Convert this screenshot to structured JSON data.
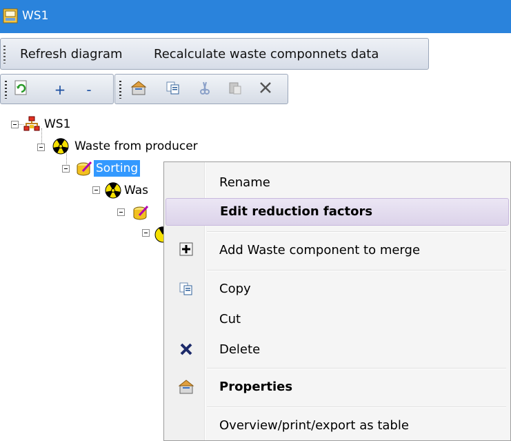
{
  "window": {
    "title": "WS1"
  },
  "menubar": {
    "refresh_label": "Refresh diagram",
    "recalc_label": "Recalculate waste componnets data"
  },
  "toolbar": {
    "plus_label": "+",
    "minus_label": "-"
  },
  "tree": {
    "root_label": "WS1",
    "node1_label": "Waste from producer",
    "node2_label": "Sorting",
    "node3_label": "Was"
  },
  "context_menu": {
    "rename": "Rename",
    "edit_reduction": "Edit reduction factors",
    "add_component": "Add Waste component to merge",
    "copy": "Copy",
    "cut": "Cut",
    "delete": "Delete",
    "properties": "Properties",
    "overview": "Overview/print/export as table"
  },
  "colors": {
    "titlebar": "#2a83dc",
    "selection": "#3399ff",
    "hover_item": "#dcd3ea"
  }
}
